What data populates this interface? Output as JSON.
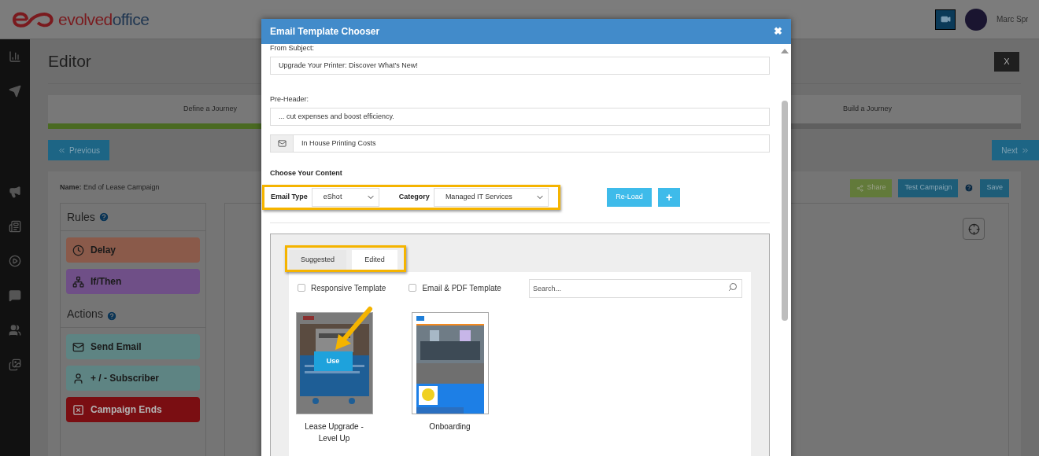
{
  "header": {
    "logo": {
      "part1": "evolved",
      "part2": "office"
    },
    "user_name": "Marc Spr"
  },
  "editor": {
    "title": "Editor",
    "close": "X",
    "steps": [
      {
        "label": "Define a Journey"
      },
      {
        "label": "Build a Journey"
      }
    ],
    "progress": {
      "level": 0.55
    },
    "previous": "Previous",
    "next": "Next",
    "name_label": "Name:",
    "name": "End of Lease Campaign",
    "buttons": [
      {
        "label": "Share",
        "kind": "share"
      },
      {
        "label": "Test Campaign",
        "kind": "test"
      },
      {
        "label": "Save",
        "kind": "save"
      }
    ],
    "rules": {
      "title": "Rules",
      "items": [
        {
          "label": "Delay",
          "kind": "delay"
        },
        {
          "label": "If/Then",
          "kind": "ifthen"
        }
      ]
    },
    "actions": {
      "title": "Actions",
      "items": [
        {
          "label": "Send Email",
          "kind": "email"
        },
        {
          "label": "+ / - Subscriber",
          "kind": "subscriber"
        },
        {
          "label": "Campaign Ends",
          "kind": "end"
        }
      ]
    }
  },
  "modal": {
    "title": "Email Template Chooser",
    "close": "✖",
    "subject_label": "From Subject:",
    "subject": "Upgrade Your Printer: Discover What's New!",
    "preheader_label": "Pre-Header:",
    "preheader": "... cut expenses and boost efficiency.",
    "email_name": "In House Printing Costs",
    "content_title": "Choose Your Content",
    "email_type_label": "Email Type",
    "email_type": "eShot",
    "category_label": "Category",
    "category": "Managed IT Services",
    "reload": "Re-Load",
    "add": "+",
    "tabs": [
      {
        "label": "Suggested",
        "selected": false
      },
      {
        "label": "Edited",
        "selected": true
      }
    ],
    "filters": [
      {
        "label": "Responsive Template",
        "checked": false
      },
      {
        "label": "Email & PDF Template",
        "checked": false
      }
    ],
    "search_placeholder": "Search...",
    "templates": [
      {
        "name": "Lease Upgrade - Level Up",
        "use": "Use",
        "kind": "printer"
      },
      {
        "name": "Onboarding",
        "kind": "office"
      }
    ]
  }
}
